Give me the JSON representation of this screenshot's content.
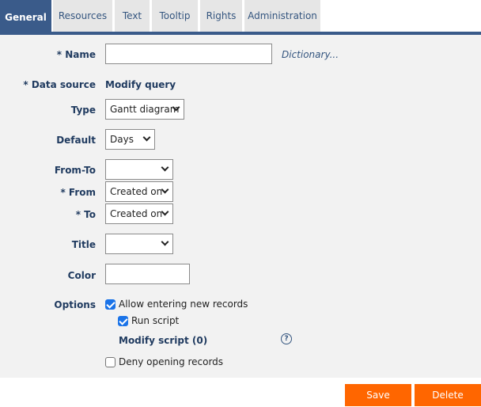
{
  "tabs": [
    {
      "label": "General",
      "active": true
    },
    {
      "label": "Resources"
    },
    {
      "label": "Text"
    },
    {
      "label": "Tooltip"
    },
    {
      "label": "Rights"
    },
    {
      "label": "Administration"
    }
  ],
  "form": {
    "name": {
      "label": "* Name",
      "value": "",
      "link": "Dictionary..."
    },
    "data_source": {
      "label": "* Data source",
      "value": "Modify query"
    },
    "type": {
      "label": "Type",
      "value": "Gantt diagram"
    },
    "default": {
      "label": "Default",
      "value": "Days"
    },
    "from_to": {
      "label": "From-To",
      "value": ""
    },
    "from": {
      "label": "* From",
      "value": "Created on"
    },
    "to": {
      "label": "* To",
      "value": "Created on"
    },
    "title": {
      "label": "Title",
      "value": ""
    },
    "color": {
      "label": "Color",
      "value": ""
    },
    "options": {
      "label": "Options",
      "allow_new": {
        "label": "Allow entering new records",
        "checked": true
      },
      "run_script": {
        "label": "Run script",
        "checked": true
      },
      "modify_script": "Modify script (0)",
      "help": "?",
      "deny_open": {
        "label": "Deny opening records",
        "checked": false
      }
    }
  },
  "buttons": {
    "save": "Save",
    "delete": "Delete"
  },
  "colors": {
    "accent": "#3a5b8a",
    "button": "#ff6600",
    "checkbox": "#1a73e8"
  }
}
